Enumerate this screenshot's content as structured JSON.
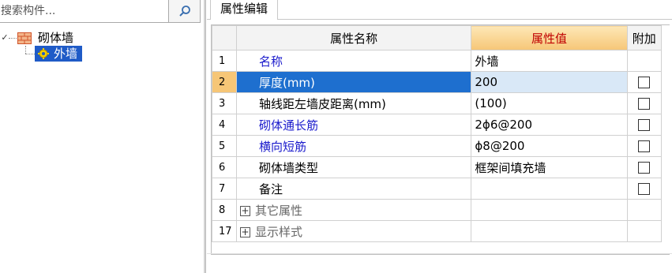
{
  "search": {
    "placeholder": "搜索构件..."
  },
  "tree": {
    "parent_label": "砌体墙",
    "child_label": "外墙"
  },
  "tab": {
    "label": "属性编辑"
  },
  "grid": {
    "headers": {
      "name": "属性名称",
      "value": "属性值",
      "extra": "附加"
    },
    "rows": [
      {
        "num": "1",
        "name": "名称",
        "value": "外墙"
      },
      {
        "num": "2",
        "name": "厚度(mm)",
        "value": "200"
      },
      {
        "num": "3",
        "name": "轴线距左墙皮距离(mm)",
        "value": "(100)"
      },
      {
        "num": "4",
        "name": "砌体通长筋",
        "value": "2ɸ6@200"
      },
      {
        "num": "5",
        "name": "横向短筋",
        "value": "ɸ8@200"
      },
      {
        "num": "6",
        "name": "砌体墙类型",
        "value": "框架间填充墙"
      },
      {
        "num": "7",
        "name": "备注",
        "value": ""
      },
      {
        "num": "8",
        "name": "其它属性"
      },
      {
        "num": "17",
        "name": "显示样式"
      }
    ]
  },
  "colors": {
    "selection_blue": "#1f5bc7",
    "header_value_orange": "#f6c677",
    "link_blue": "#1a1acc"
  }
}
